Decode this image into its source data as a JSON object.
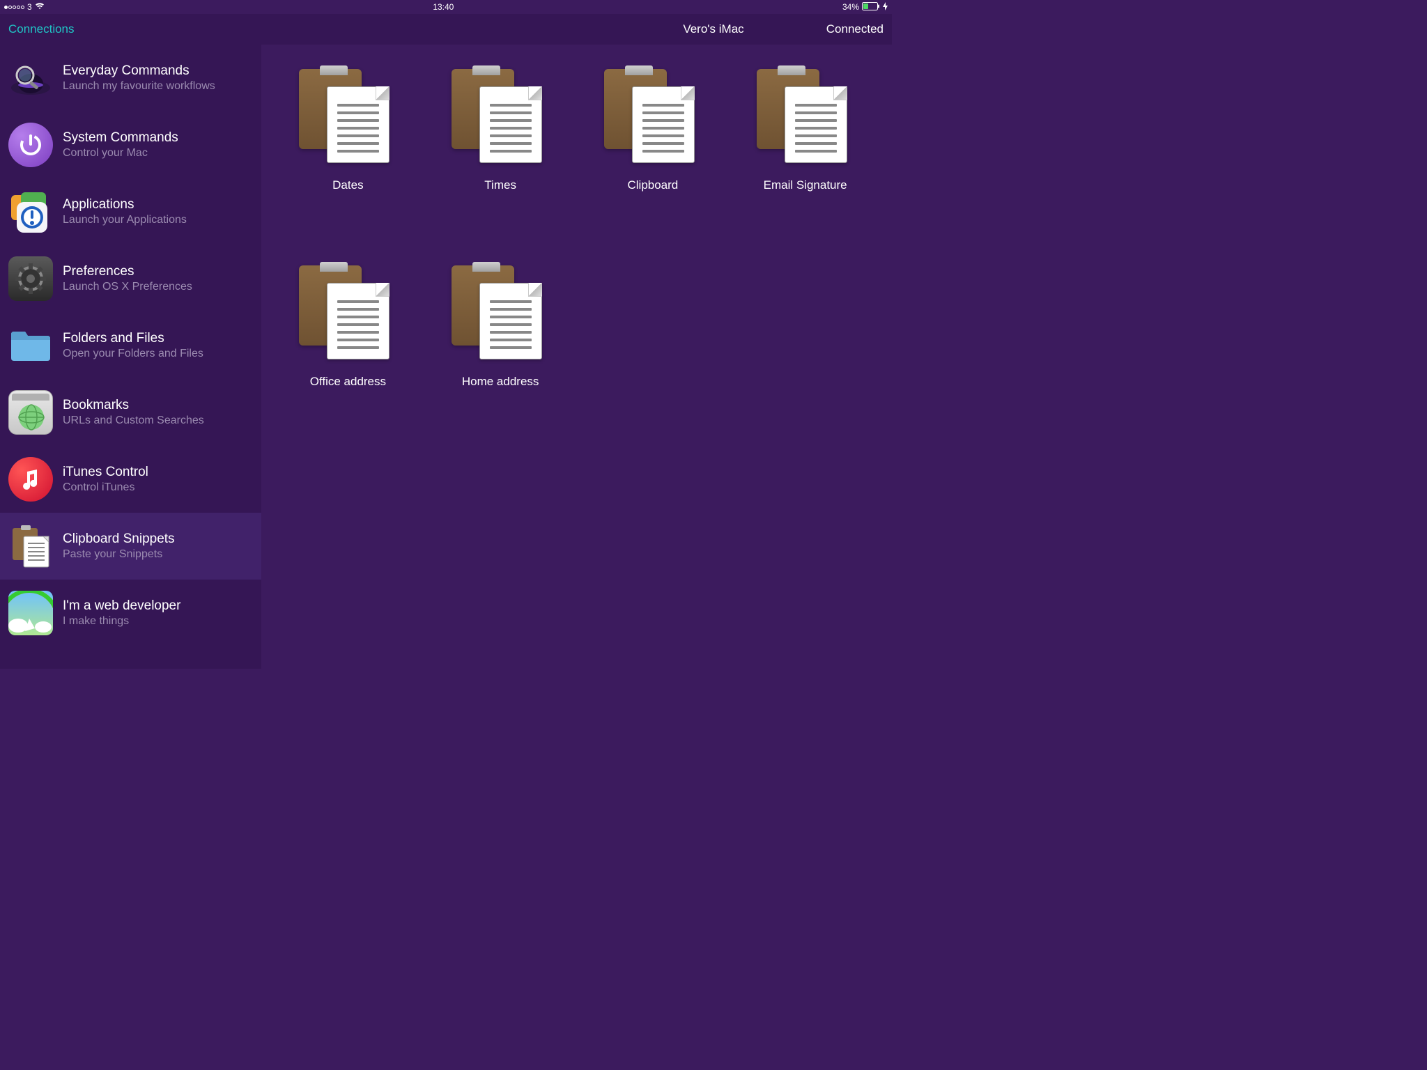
{
  "status": {
    "carrier": "3",
    "time": "13:40",
    "battery": "34%"
  },
  "header": {
    "connections": "Connections",
    "title": "Vero's iMac",
    "status": "Connected"
  },
  "sidebar": {
    "items": [
      {
        "title": "Everyday Commands",
        "subtitle": "Launch my favourite workflows"
      },
      {
        "title": "System Commands",
        "subtitle": "Control your Mac"
      },
      {
        "title": "Applications",
        "subtitle": "Launch your Applications"
      },
      {
        "title": "Preferences",
        "subtitle": "Launch OS X Preferences"
      },
      {
        "title": "Folders and Files",
        "subtitle": "Open your Folders and Files"
      },
      {
        "title": "Bookmarks",
        "subtitle": "URLs and Custom Searches"
      },
      {
        "title": "iTunes Control",
        "subtitle": "Control iTunes"
      },
      {
        "title": "Clipboard Snippets",
        "subtitle": "Paste your Snippets"
      },
      {
        "title": "I'm a web developer",
        "subtitle": "I make things"
      }
    ]
  },
  "grid": {
    "items": [
      {
        "label": "Dates"
      },
      {
        "label": "Times"
      },
      {
        "label": "Clipboard"
      },
      {
        "label": "Email Signature"
      },
      {
        "label": "Office address"
      },
      {
        "label": "Home address"
      }
    ]
  }
}
